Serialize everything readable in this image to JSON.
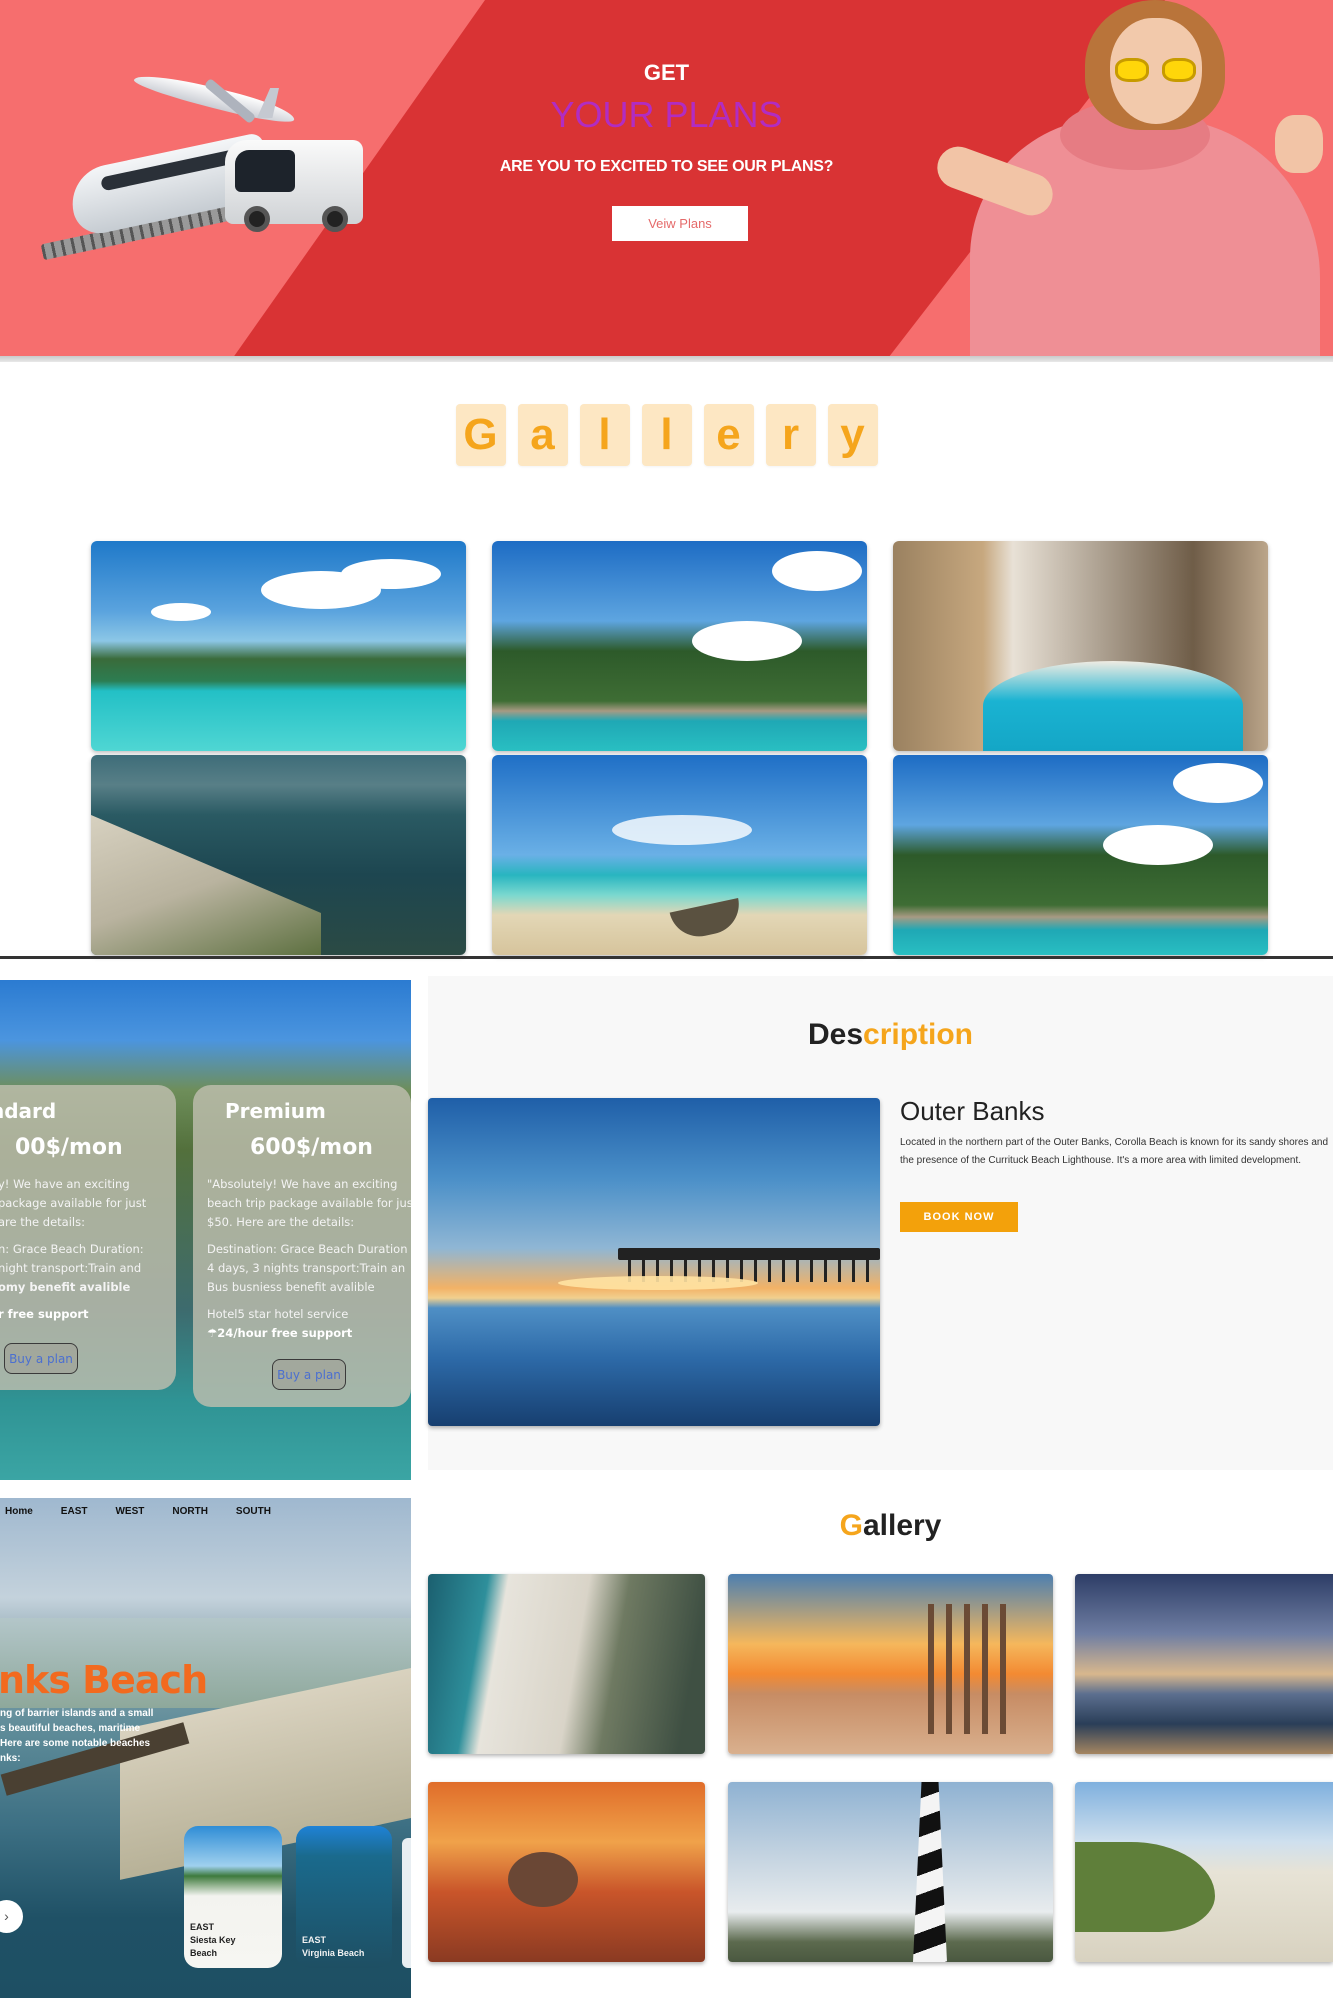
{
  "hero": {
    "get": "GET",
    "your_plans": "YOUR PLANS",
    "question": "ARE YOU TO EXCITED TO SEE OUR PLANS?",
    "button": "Veiw Plans"
  },
  "gallery": {
    "letters": [
      "G",
      "a",
      "l",
      "l",
      "e",
      "r",
      "y"
    ]
  },
  "pricing": {
    "standard": {
      "name": "ndard",
      "price": "00$/mon",
      "lines": [
        "y! We have an exciting",
        "package available for just",
        "are the details:"
      ],
      "details": [
        "n: Grace Beach Duration:",
        "night transport:Train and",
        "omy benefit avalible"
      ],
      "support": "r free support",
      "buy": "Buy a plan"
    },
    "premium": {
      "name": "Premium",
      "price": "600$/mon",
      "lines": [
        "\"Absolutely! We have an exciting",
        "beach trip package available for jus",
        "$50. Here are the details:"
      ],
      "details": [
        "Destination: Grace Beach Duration",
        "4 days, 3 nights transport:Train an",
        "Bus busniess benefit avalible"
      ],
      "hotel": "Hotel5 star hotel service",
      "support": "☂24/hour free support",
      "buy": "Buy a plan"
    }
  },
  "beach": {
    "nav": [
      "Home",
      "EAST",
      "WEST",
      "NORTH",
      "SOUTH"
    ],
    "title": "nks Beach",
    "para": [
      "ng of barrier islands and a small",
      "s beautiful beaches, maritime",
      "Here are some notable beaches",
      "nks:"
    ],
    "slider_button": "›",
    "cards": [
      {
        "region": "EAST",
        "name": "Siesta Key Beach"
      },
      {
        "region": "EAST",
        "name": "Virginia Beach"
      }
    ]
  },
  "description": {
    "title_dark": "Des",
    "title_highlight": "cription",
    "place": "Outer Banks",
    "text": "Located in the northern part of the Outer Banks, Corolla Beach is known for its sandy shores and the presence of the Currituck Beach Lighthouse. It's a more area with limited development.",
    "button": "BOOK NOW"
  },
  "gallery2": {
    "title_highlight": "G",
    "title_dark": "allery"
  },
  "colors": {
    "hero_bg": "#f66e6e",
    "hero_band": "#d93334",
    "plans_purple": "#b12cc3",
    "accent_orange": "#f5a51c",
    "book_btn": "#f3a10b",
    "beach_title": "#f26a1f"
  }
}
